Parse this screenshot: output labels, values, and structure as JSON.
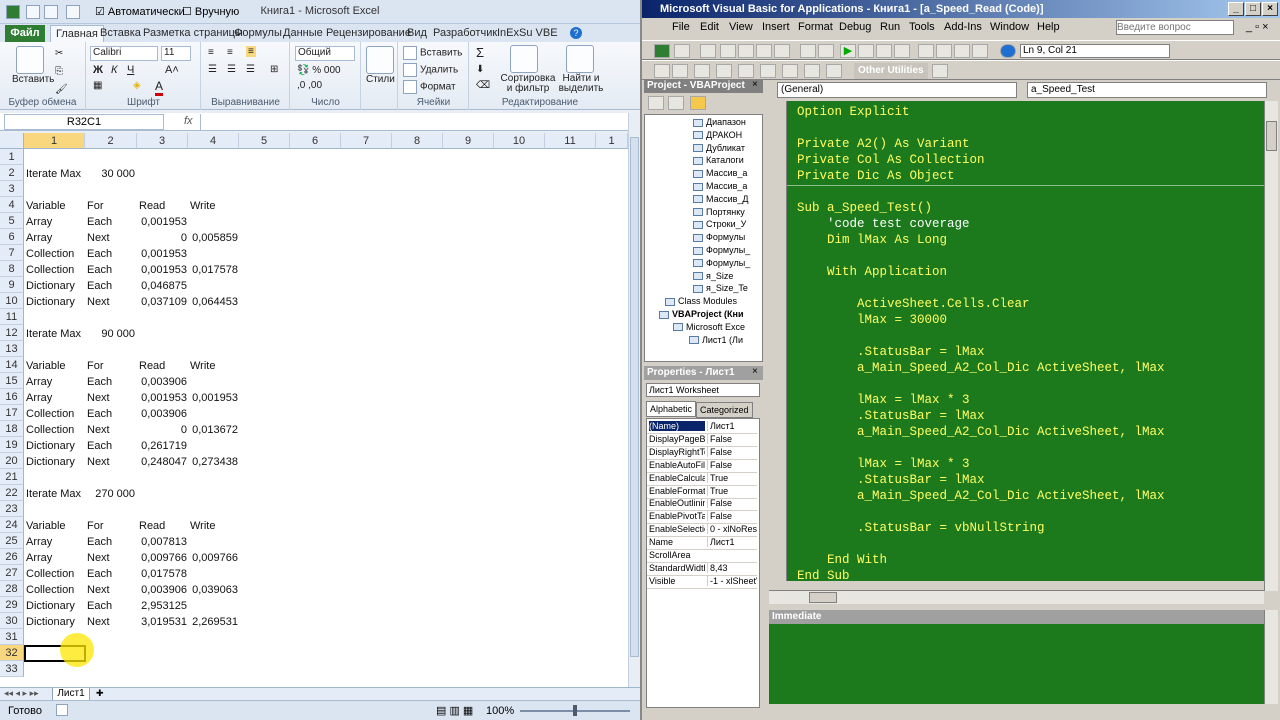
{
  "excel": {
    "title": "Книга1 - Microsoft Excel",
    "qat": {
      "auto_label": "Автоматически",
      "manual_label": "Вручную"
    },
    "tabs": [
      "Файл",
      "Главная",
      "Вставка",
      "Разметка страницы",
      "Формулы",
      "Данные",
      "Рецензирование",
      "Вид",
      "Разработчик",
      "InExSu VBE"
    ],
    "ribbon": {
      "paste": "Вставить",
      "clipboard": "Буфер обмена",
      "font_name": "Calibri",
      "font_size": "11",
      "font_group": "Шрифт",
      "align_group": "Выравнивание",
      "number_format": "Общий",
      "number_group": "Число",
      "styles": "Стили",
      "insert": "Вставить",
      "delete": "Удалить",
      "format": "Формат",
      "cells_group": "Ячейки",
      "sort": "Сортировка и фильтр",
      "find": "Найти и выделить",
      "edit_group": "Редактирование",
      "sum_sym": "Σ"
    },
    "namebox": "R32C1",
    "fx": "fx",
    "col_headers": [
      "1",
      "2",
      "3",
      "4",
      "5",
      "6",
      "7",
      "8",
      "9",
      "10",
      "11",
      "1"
    ],
    "rows": [
      {
        "n": "1",
        "c": [
          "",
          "",
          "",
          ""
        ]
      },
      {
        "n": "2",
        "c": [
          "Iterate Max",
          "30 000",
          "",
          ""
        ]
      },
      {
        "n": "3",
        "c": [
          "",
          "",
          "",
          ""
        ]
      },
      {
        "n": "4",
        "c": [
          "Variable",
          "For",
          "Read",
          "Write"
        ]
      },
      {
        "n": "5",
        "c": [
          "Array",
          "Each",
          "0,001953",
          ""
        ]
      },
      {
        "n": "6",
        "c": [
          "Array",
          "Next",
          "0",
          "0,005859"
        ]
      },
      {
        "n": "7",
        "c": [
          "Collection",
          "Each",
          "0,001953",
          ""
        ]
      },
      {
        "n": "8",
        "c": [
          "Collection",
          "Each",
          "0,001953",
          "0,017578"
        ]
      },
      {
        "n": "9",
        "c": [
          "Dictionary",
          "Each",
          "0,046875",
          ""
        ]
      },
      {
        "n": "10",
        "c": [
          "Dictionary",
          "Next",
          "0,037109",
          "0,064453"
        ]
      },
      {
        "n": "11",
        "c": [
          "",
          "",
          "",
          ""
        ]
      },
      {
        "n": "12",
        "c": [
          "Iterate Max",
          "90 000",
          "",
          ""
        ]
      },
      {
        "n": "13",
        "c": [
          "",
          "",
          "",
          ""
        ]
      },
      {
        "n": "14",
        "c": [
          "Variable",
          "For",
          "Read",
          "Write"
        ]
      },
      {
        "n": "15",
        "c": [
          "Array",
          "Each",
          "0,003906",
          ""
        ]
      },
      {
        "n": "16",
        "c": [
          "Array",
          "Next",
          "0,001953",
          "0,001953"
        ]
      },
      {
        "n": "17",
        "c": [
          "Collection",
          "Each",
          "0,003906",
          ""
        ]
      },
      {
        "n": "18",
        "c": [
          "Collection",
          "Next",
          "0",
          "0,013672"
        ]
      },
      {
        "n": "19",
        "c": [
          "Dictionary",
          "Each",
          "0,261719",
          ""
        ]
      },
      {
        "n": "20",
        "c": [
          "Dictionary",
          "Next",
          "0,248047",
          "0,273438"
        ]
      },
      {
        "n": "21",
        "c": [
          "",
          "",
          "",
          ""
        ]
      },
      {
        "n": "22",
        "c": [
          "Iterate Max",
          "270 000",
          "",
          ""
        ]
      },
      {
        "n": "23",
        "c": [
          "",
          "",
          "",
          ""
        ]
      },
      {
        "n": "24",
        "c": [
          "Variable",
          "For",
          "Read",
          "Write"
        ]
      },
      {
        "n": "25",
        "c": [
          "Array",
          "Each",
          "0,007813",
          ""
        ]
      },
      {
        "n": "26",
        "c": [
          "Array",
          "Next",
          "0,009766",
          "0,009766"
        ]
      },
      {
        "n": "27",
        "c": [
          "Collection",
          "Each",
          "0,017578",
          ""
        ]
      },
      {
        "n": "28",
        "c": [
          "Collection",
          "Next",
          "0,003906",
          "0,039063"
        ]
      },
      {
        "n": "29",
        "c": [
          "Dictionary",
          "Each",
          "2,953125",
          ""
        ]
      },
      {
        "n": "30",
        "c": [
          "Dictionary",
          "Next",
          "3,019531",
          "2,269531"
        ]
      },
      {
        "n": "31",
        "c": [
          "",
          "",
          "",
          ""
        ]
      },
      {
        "n": "32",
        "c": [
          "",
          "",
          "",
          ""
        ]
      },
      {
        "n": "33",
        "c": [
          "",
          "",
          "",
          ""
        ]
      }
    ],
    "sheet_tab": "Лист1",
    "status": "Готово",
    "zoom": "100%"
  },
  "vbe": {
    "title": "Microsoft Visual Basic for Applications - Книга1 - [a_Speed_Read (Code)]",
    "menu": [
      "File",
      "Edit",
      "View",
      "Insert",
      "Format",
      "Debug",
      "Run",
      "Tools",
      "Add-Ins",
      "Window",
      "Help"
    ],
    "ask_placeholder": "Введите вопрос",
    "position": "Ln 9, Col 21",
    "other_utilities": "Other Utilities",
    "project_title": "Project - VBAProject",
    "tree": [
      "Диапазон",
      "ДРАКОН",
      "Дубликат",
      "Каталоги",
      "Массив_а",
      "Массив_а",
      "Массив_Д",
      "Портянку",
      "Строки_У",
      "Формулы",
      "Формулы_",
      "Формулы_",
      "я_Size",
      "я_Size_Te",
      "Class Modules",
      "VBAProject (Кни",
      "Microsoft Exce",
      "Лист1 (Ли"
    ],
    "properties_title": "Properties - Лист1",
    "props_object": "Лист1 Worksheet",
    "props_tabs": [
      "Alphabetic",
      "Categorized"
    ],
    "props": [
      {
        "n": "(Name)",
        "v": "Лист1"
      },
      {
        "n": "DisplayPageBr",
        "v": "False"
      },
      {
        "n": "DisplayRightTo",
        "v": "False"
      },
      {
        "n": "EnableAutoFilt",
        "v": "False"
      },
      {
        "n": "EnableCalculat",
        "v": "True"
      },
      {
        "n": "EnableFormatC",
        "v": "True"
      },
      {
        "n": "EnableOutlinin",
        "v": "False"
      },
      {
        "n": "EnablePivotTal",
        "v": "False"
      },
      {
        "n": "EnableSelectio",
        "v": "0 - xlNoRestr"
      },
      {
        "n": "Name",
        "v": "Лист1"
      },
      {
        "n": "ScrollArea",
        "v": ""
      },
      {
        "n": "StandardWidth",
        "v": "8,43"
      },
      {
        "n": "Visible",
        "v": "-1 - xlSheetV"
      }
    ],
    "combo_general": "(General)",
    "combo_proc": "a_Speed_Test",
    "immediate_title": "Immediate",
    "code": [
      {
        "t": "Option Explicit",
        "c": false
      },
      {
        "t": "",
        "c": false
      },
      {
        "t": "Private A2() As Variant",
        "c": false
      },
      {
        "t": "Private Col As Collection",
        "c": false
      },
      {
        "t": "Private Dic As Object",
        "c": false
      },
      {
        "t": "",
        "c": false
      },
      {
        "t": "Sub a_Speed_Test()",
        "c": false
      },
      {
        "t": "    'code test coverage",
        "c": true
      },
      {
        "t": "    Dim lMax As Long",
        "c": false
      },
      {
        "t": "",
        "c": false
      },
      {
        "t": "    With Application",
        "c": false
      },
      {
        "t": "",
        "c": false
      },
      {
        "t": "        ActiveSheet.Cells.Clear",
        "c": false
      },
      {
        "t": "        lMax = 30000",
        "c": false
      },
      {
        "t": "",
        "c": false
      },
      {
        "t": "        .StatusBar = lMax",
        "c": false
      },
      {
        "t": "        a_Main_Speed_A2_Col_Dic ActiveSheet, lMax",
        "c": false
      },
      {
        "t": "",
        "c": false
      },
      {
        "t": "        lMax = lMax * 3",
        "c": false
      },
      {
        "t": "        .StatusBar = lMax",
        "c": false
      },
      {
        "t": "        a_Main_Speed_A2_Col_Dic ActiveSheet, lMax",
        "c": false
      },
      {
        "t": "",
        "c": false
      },
      {
        "t": "        lMax = lMax * 3",
        "c": false
      },
      {
        "t": "        .StatusBar = lMax",
        "c": false
      },
      {
        "t": "        a_Main_Speed_A2_Col_Dic ActiveSheet, lMax",
        "c": false
      },
      {
        "t": "",
        "c": false
      },
      {
        "t": "        .StatusBar = vbNullString",
        "c": false
      },
      {
        "t": "",
        "c": false
      },
      {
        "t": "    End With",
        "c": false
      },
      {
        "t": "End Sub",
        "c": false
      }
    ]
  }
}
